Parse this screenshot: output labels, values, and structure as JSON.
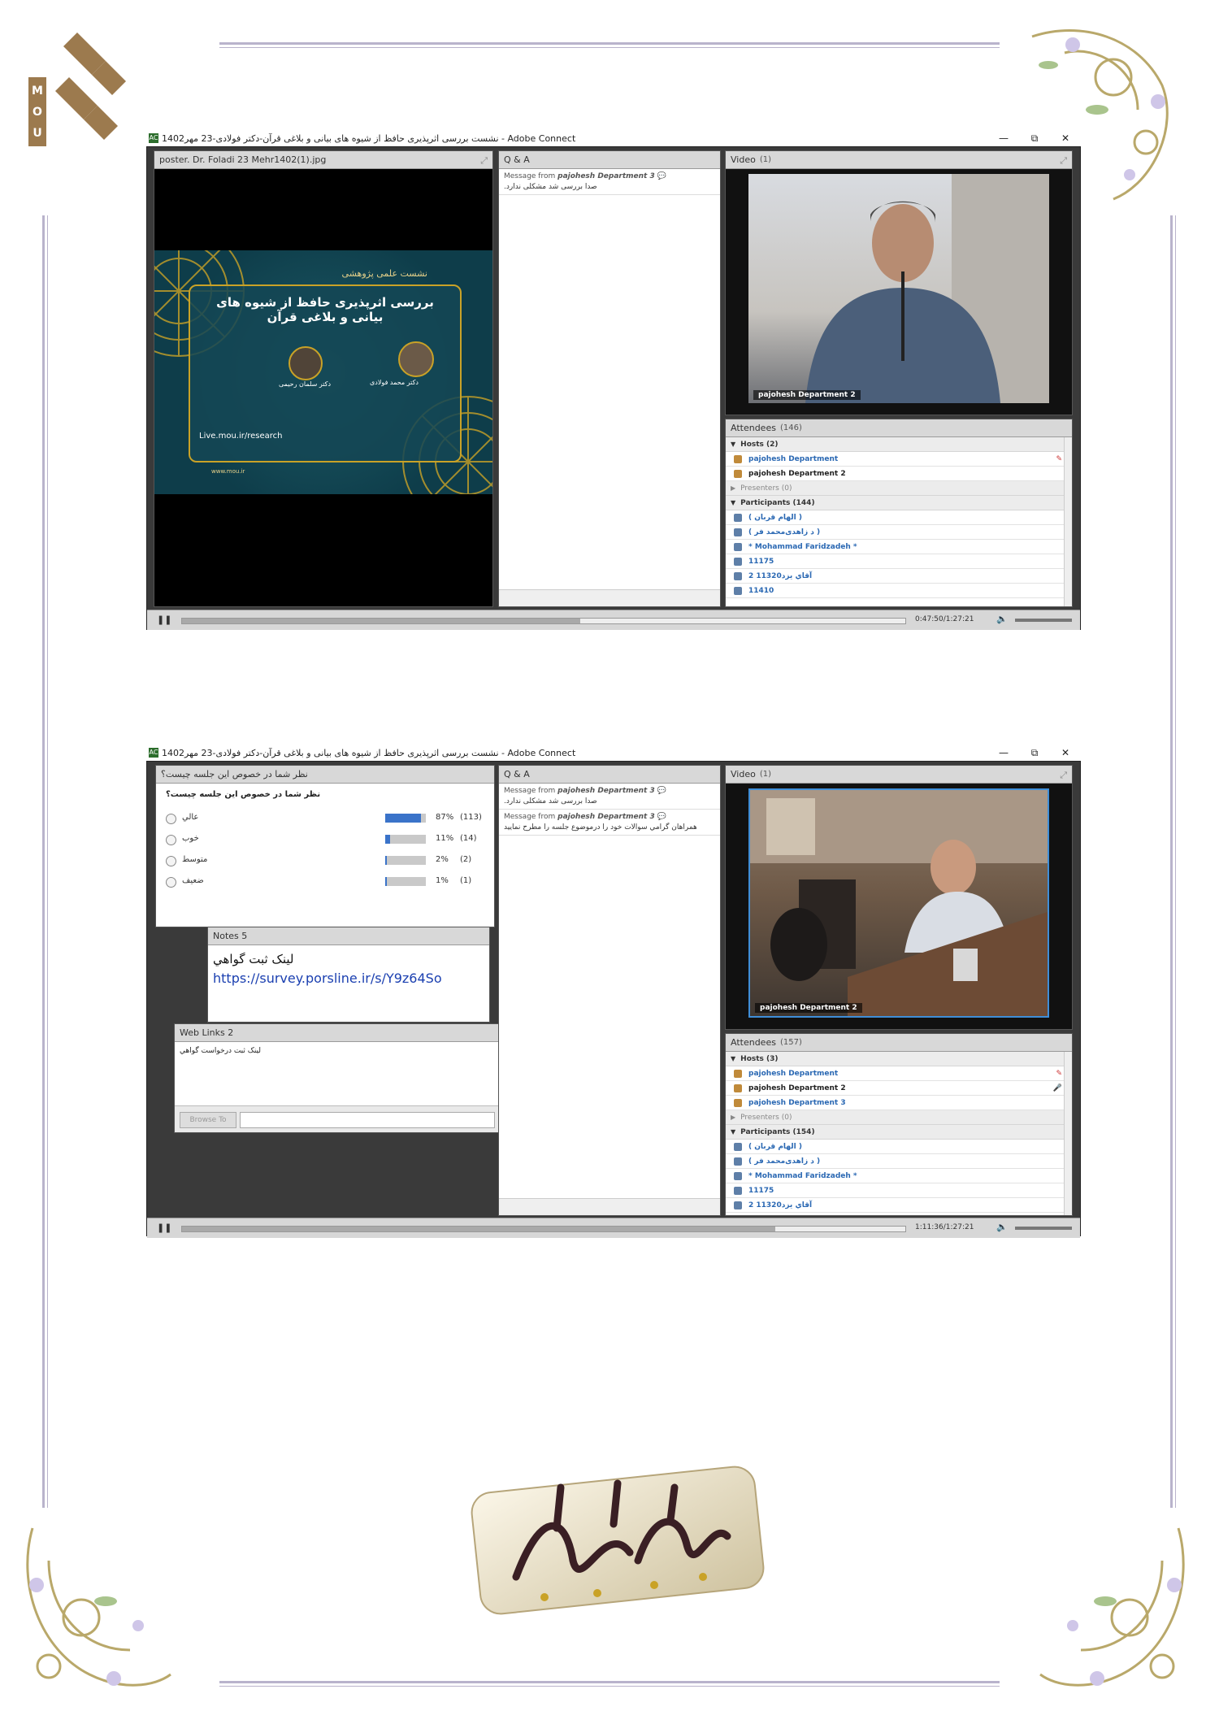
{
  "brand": {
    "logo_text": "MOU"
  },
  "window": {
    "title": "نشست بررسی اثرپذیری حافظ از شیوه های بیانی و بلاغی قرآن-دکتر فولادی-23 مهر1402 - Adobe Connect",
    "app_icon": "adobe-connect-icon",
    "minimize": "—",
    "restore": "⧉",
    "close": "✕"
  },
  "screen1": {
    "share_pod": {
      "title": "poster. Dr. Foladi 23 Mehr1402(1).jpg"
    },
    "poster": {
      "header": "نشست علمی پژوهشی",
      "title": "بررسی اثرپذیری حافظ از شیوه های بیانی و بلاغی قرآن",
      "speaker1": "دکتر محمد فولادی",
      "speaker2": "دکتر سلمان رحیمی",
      "url": "Live.mou.ir/research",
      "site": "www.mou.ir"
    },
    "qa": {
      "title": "Q & A",
      "messages": [
        {
          "from_prefix": "Message from",
          "from_name": "pajohesh Department 3",
          "body": "صدا بررسی شد مشکلی ندارد."
        }
      ]
    },
    "video": {
      "title": "Video",
      "count": "(1)",
      "caption": "pajohesh Department 2"
    },
    "attendees": {
      "title": "Attendees",
      "count": "(146)",
      "hosts_label": "Hosts (2)",
      "hosts": [
        "pajohesh Department",
        "pajohesh Department 2"
      ],
      "presenters_label": "Presenters (0)",
      "participants_label": "Participants (144)",
      "participants": [
        "( الهام قربان )",
        "( د زاهدی‌محمد فر )",
        "* Mohammad Faridzadeh *",
        "11175",
        "2 11320آقاي يزد",
        "11410"
      ]
    },
    "status": {
      "time": "0:47:50/1:27:21",
      "progress": 0.55
    }
  },
  "screen2": {
    "poll": {
      "title": "نظر شما در خصوص  این جلسه چیست؟",
      "question": "نظر شما در خصوص  این جلسه چیست؟",
      "options": [
        {
          "label": "عالي",
          "percent": "87%",
          "count": "(113)",
          "fill": 0.87
        },
        {
          "label": "خوب",
          "percent": "11%",
          "count": "(14)",
          "fill": 0.11
        },
        {
          "label": "متوسط",
          "percent": "2%",
          "count": "(2)",
          "fill": 0.02
        },
        {
          "label": "ضعیف",
          "percent": "1%",
          "count": "(1)",
          "fill": 0.01
        }
      ]
    },
    "notes": {
      "title": "Notes 5",
      "line1": "لینک ثبت گواهي",
      "link": "https://survey.porsline.ir/s/Y9z64So"
    },
    "weblinks": {
      "title": "Web Links 2",
      "item": "لینک ثبت درخواست گواهي",
      "browse": "Browse To"
    },
    "qa": {
      "title": "Q & A",
      "messages": [
        {
          "from_prefix": "Message from",
          "from_name": "pajohesh Department 3",
          "body": "صدا بررسی شد مشکلی ندارد."
        },
        {
          "from_prefix": "Message from",
          "from_name": "pajohesh Department 3",
          "body": "همراهان گرامي سوالات خود را درموضوع جلسه را مطرح نمایید"
        }
      ]
    },
    "video": {
      "title": "Video",
      "count": "(1)",
      "caption": "pajohesh Department 2"
    },
    "attendees": {
      "title": "Attendees",
      "count": "(157)",
      "hosts_label": "Hosts (3)",
      "hosts": [
        "pajohesh Department",
        "pajohesh Department 2",
        "pajohesh Department 3"
      ],
      "presenters_label": "Presenters (0)",
      "participants_label": "Participants (154)",
      "participants": [
        "( الهام قربان )",
        "( د زاهدی‌محمد فر )",
        "* Mohammad Faridzadeh *",
        "11175",
        "2 11320آقاي يزد"
      ]
    },
    "status": {
      "time": "1:11:36/1:27:21",
      "progress": 0.82
    }
  },
  "calligraphy": {
    "icon": "salawat-calligraphy-icon"
  },
  "colors": {
    "link": "#2a68b3",
    "poll_bar": "#3a73c9",
    "poster_bg": "#0e3d4a",
    "gold": "#c9a227"
  }
}
